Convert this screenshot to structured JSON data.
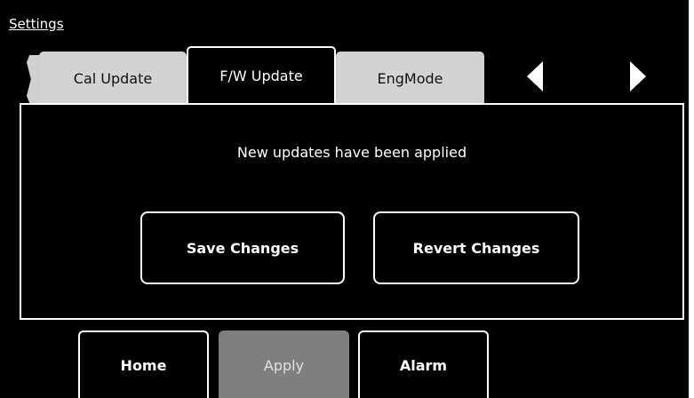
{
  "header": {
    "title": "Settings"
  },
  "tabs": [
    {
      "label": "Cal Update",
      "state": "inactive"
    },
    {
      "label": "F/W Update",
      "state": "active"
    },
    {
      "label": "EngMode",
      "state": "inactive"
    }
  ],
  "nav": {
    "prev_icon": "triangle-left",
    "next_icon": "triangle-right"
  },
  "panel": {
    "message": "New updates have been applied",
    "save_label": "Save Changes",
    "revert_label": "Revert Changes"
  },
  "bottom": {
    "home_label": "Home",
    "apply_label": "Apply",
    "alarm_label": "Alarm"
  },
  "colors": {
    "background": "#000000",
    "text": "#ffffff",
    "tab_inactive": "#d3d3d3",
    "apply_disabled": "#7f7f7f"
  }
}
